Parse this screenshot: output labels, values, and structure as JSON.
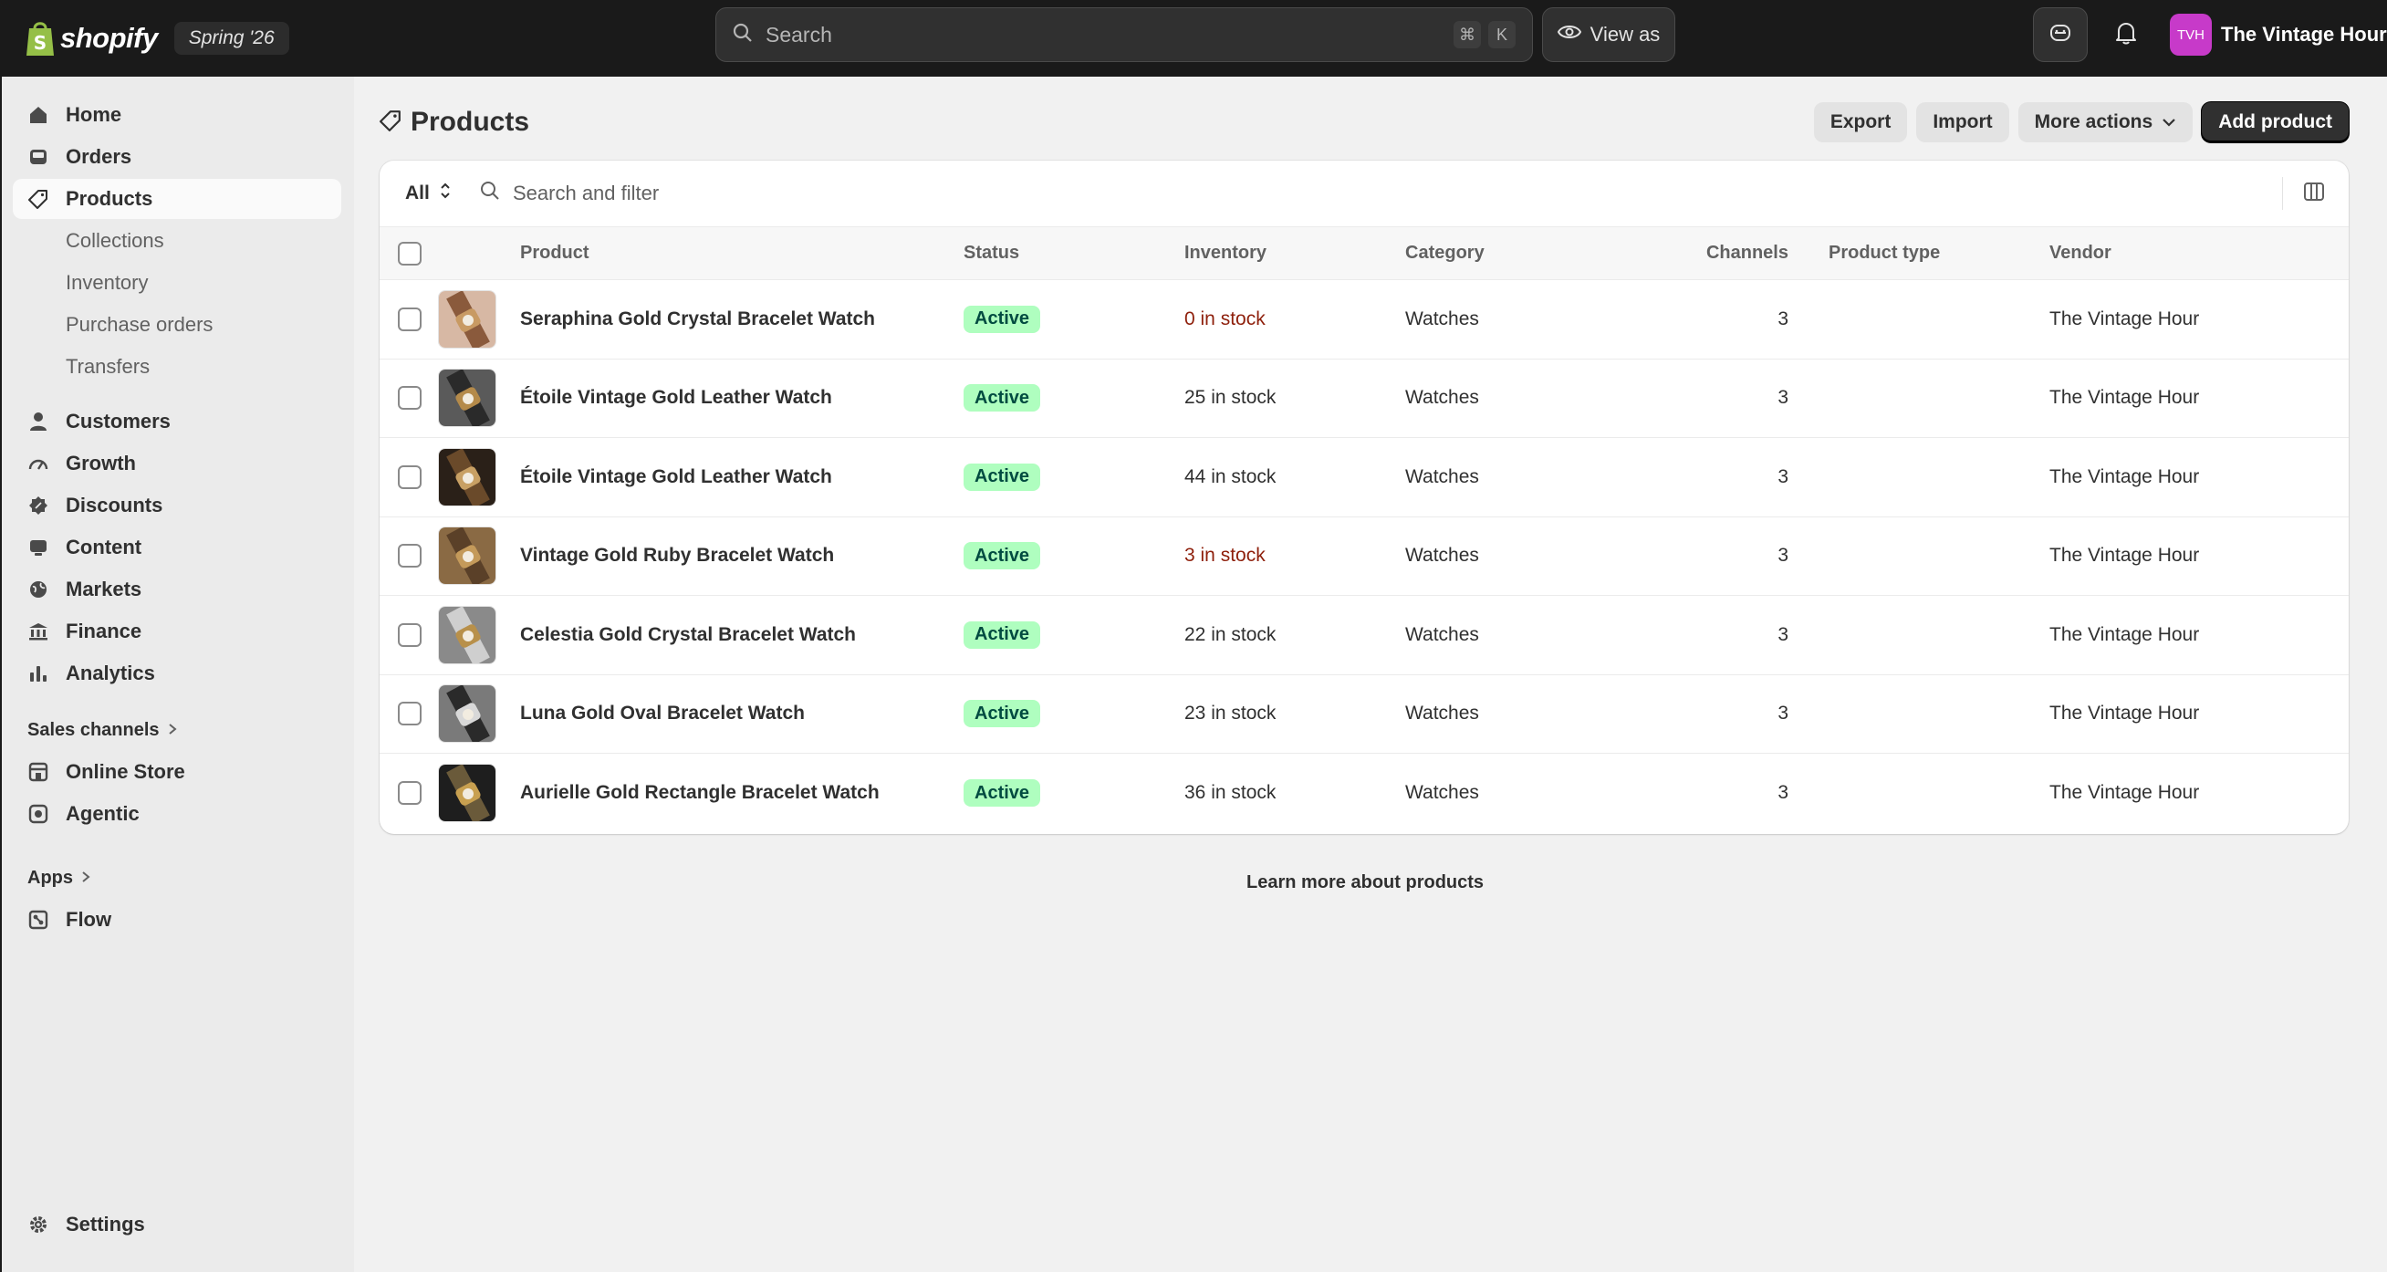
{
  "topbar": {
    "brand_word": "shopify",
    "edition_badge": "Spring '26",
    "search_placeholder": "Search",
    "shortcut_keys": [
      "⌘",
      "K"
    ],
    "view_as_label": "View as",
    "store_initials": "TVH",
    "store_name": "The Vintage Hour",
    "avatar_color": "#c73ac9"
  },
  "sidebar": {
    "primary": [
      {
        "label": "Home",
        "icon": "home-icon"
      },
      {
        "label": "Orders",
        "icon": "inbox-icon"
      },
      {
        "label": "Products",
        "icon": "tag-icon",
        "active": true
      }
    ],
    "product_sub": [
      "Collections",
      "Inventory",
      "Purchase orders",
      "Transfers"
    ],
    "secondary": [
      {
        "label": "Customers",
        "icon": "person-icon"
      },
      {
        "label": "Growth",
        "icon": "gauge-icon"
      },
      {
        "label": "Discounts",
        "icon": "discount-icon"
      },
      {
        "label": "Content",
        "icon": "content-icon"
      },
      {
        "label": "Markets",
        "icon": "globe-icon"
      },
      {
        "label": "Finance",
        "icon": "bank-icon"
      },
      {
        "label": "Analytics",
        "icon": "bar-chart-icon"
      }
    ],
    "sales_channels_label": "Sales channels",
    "sales_channels": [
      {
        "label": "Online Store",
        "icon": "storefront-icon"
      },
      {
        "label": "Agentic",
        "icon": "agentic-icon"
      }
    ],
    "apps_label": "Apps",
    "apps": [
      {
        "label": "Flow",
        "icon": "flow-icon"
      }
    ],
    "settings_label": "Settings"
  },
  "page": {
    "title": "Products",
    "actions": {
      "export": "Export",
      "import": "Import",
      "more": "More actions",
      "add": "Add product"
    },
    "filter": {
      "tab": "All",
      "search_placeholder": "Search and filter"
    },
    "columns": [
      "Product",
      "Status",
      "Inventory",
      "Category",
      "Channels",
      "Product type",
      "Vendor"
    ],
    "rows": [
      {
        "name": "Seraphina Gold Crystal Bracelet Watch",
        "status": "Active",
        "inventory": "0 in stock",
        "low": true,
        "category": "Watches",
        "channels": "3",
        "type": "",
        "vendor": "The Vintage Hour"
      },
      {
        "name": "Étoile Vintage Gold Leather Watch",
        "status": "Active",
        "inventory": "25 in stock",
        "low": false,
        "category": "Watches",
        "channels": "3",
        "type": "",
        "vendor": "The Vintage Hour"
      },
      {
        "name": "Étoile Vintage Gold Leather Watch",
        "status": "Active",
        "inventory": "44 in stock",
        "low": false,
        "category": "Watches",
        "channels": "3",
        "type": "",
        "vendor": "The Vintage Hour"
      },
      {
        "name": "Vintage Gold Ruby Bracelet Watch",
        "status": "Active",
        "inventory": "3 in stock",
        "low": true,
        "category": "Watches",
        "channels": "3",
        "type": "",
        "vendor": "The Vintage Hour"
      },
      {
        "name": "Celestia Gold Crystal Bracelet Watch",
        "status": "Active",
        "inventory": "22 in stock",
        "low": false,
        "category": "Watches",
        "channels": "3",
        "type": "",
        "vendor": "The Vintage Hour"
      },
      {
        "name": "Luna Gold Oval Bracelet Watch",
        "status": "Active",
        "inventory": "23 in stock",
        "low": false,
        "category": "Watches",
        "channels": "3",
        "type": "",
        "vendor": "The Vintage Hour"
      },
      {
        "name": "Aurielle Gold Rectangle Bracelet Watch",
        "status": "Active",
        "inventory": "36 in stock",
        "low": false,
        "category": "Watches",
        "channels": "3",
        "type": "",
        "vendor": "The Vintage Hour"
      }
    ],
    "learn_more": "Learn more about products"
  },
  "colors": {
    "topbar_bg": "#1a1a1a",
    "active_badge_bg": "#affebf",
    "active_badge_text": "#014b40",
    "low_stock_text": "#8e1f0b",
    "primary_button": "#303030"
  }
}
